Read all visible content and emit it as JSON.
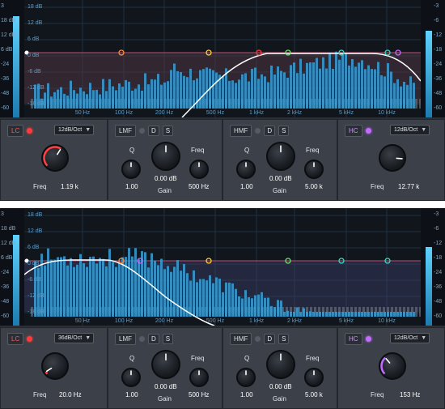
{
  "meter_scale_left": [
    "3",
    "18 dB",
    "12 dB",
    "6 dB",
    "-24",
    "-36",
    "-48",
    "-60"
  ],
  "meter_scale_right": [
    "-3",
    "-6",
    "-12",
    "-18",
    "-24",
    "-36",
    "-48",
    "-60"
  ],
  "db_labels": [
    "18 dB",
    "12 dB",
    "6 dB",
    "0 dB",
    "-6 dB",
    "-12 dB",
    "-18 dB"
  ],
  "freq_labels": [
    "50 Hz",
    "100 Hz",
    "200 Hz",
    "500 Hz",
    "1 kHz",
    "2 kHz",
    "5 kHz",
    "10 kHz"
  ],
  "colors": {
    "graph_bg": "#11161d",
    "spectrum": "#3a9fd6",
    "curve": "#ffffff",
    "lc_accent": "#ff4040",
    "hc_accent": "#c36bff",
    "band_bg": "#3b4049"
  },
  "instances": [
    {
      "id": "top",
      "meter_left_level": 0.86,
      "meter_right_level": 0.74,
      "lc": {
        "label": "LC",
        "slope": "12dB/Oct",
        "freq_caption": "Freq",
        "freq_value": "1.19 k",
        "knob": 0.62,
        "on": true
      },
      "lmf": {
        "label": "LMF",
        "d": "D",
        "s": "S",
        "q_caption": "Q",
        "q_value": "1.00",
        "gain_value": "0.00 dB",
        "gain_caption": "Gain",
        "freq_caption": "Freq",
        "freq_value": "500 Hz"
      },
      "hmf": {
        "label": "HMF",
        "d": "D",
        "s": "S",
        "q_caption": "Q",
        "q_value": "1.00",
        "gain_value": "0.00 dB",
        "gain_caption": "Gain",
        "freq_caption": "Freq",
        "freq_value": "5.00 k"
      },
      "hc": {
        "label": "HC",
        "slope": "12dB/Oct",
        "freq_caption": "Freq",
        "freq_value": "12.77 k",
        "knob": 0.85,
        "on": true
      }
    },
    {
      "id": "bottom",
      "meter_left_level": 0.77,
      "meter_right_level": 0.67,
      "lc": {
        "label": "LC",
        "slope": "36dB/Oct",
        "freq_caption": "Freq",
        "freq_value": "20.0 Hz",
        "knob": 0.05,
        "on": true
      },
      "lmf": {
        "label": "LMF",
        "d": "D",
        "s": "S",
        "q_caption": "Q",
        "q_value": "1.00",
        "gain_value": "0.00 dB",
        "gain_caption": "Gain",
        "freq_caption": "Freq",
        "freq_value": "500 Hz"
      },
      "hmf": {
        "label": "HMF",
        "d": "D",
        "s": "S",
        "q_caption": "Q",
        "q_value": "1.00",
        "gain_value": "0.00 dB",
        "gain_caption": "Gain",
        "freq_caption": "Freq",
        "freq_value": "5.00 k"
      },
      "hc": {
        "label": "HC",
        "slope": "12dB/Oct",
        "freq_caption": "Freq",
        "freq_value": "153 Hz",
        "knob": 0.35,
        "on": true
      }
    }
  ]
}
